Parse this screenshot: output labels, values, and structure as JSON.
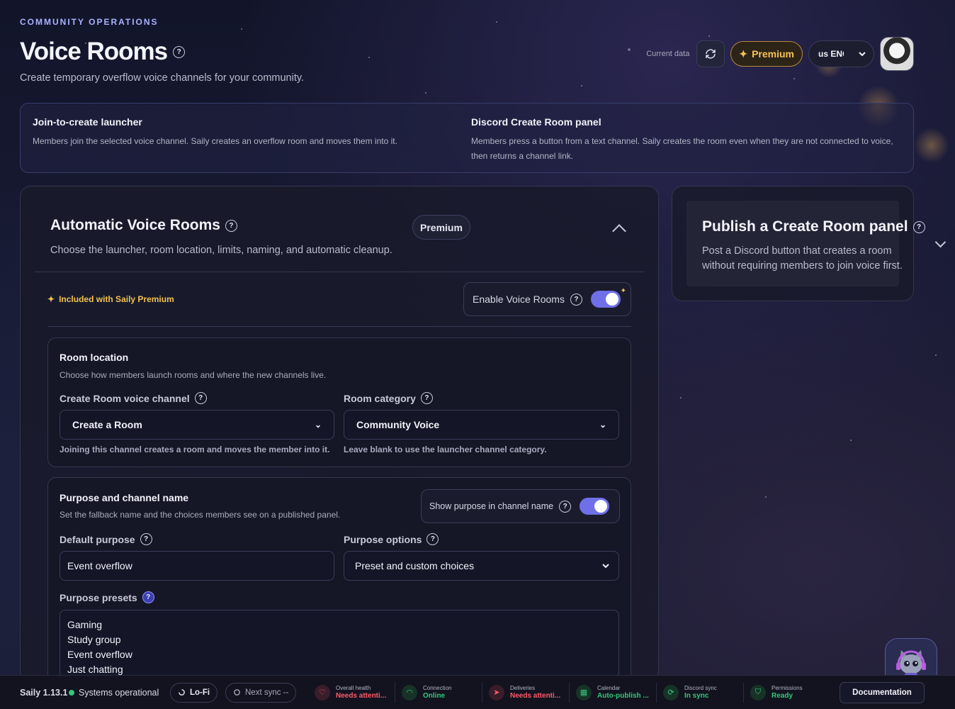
{
  "header": {
    "eyebrow": "COMMUNITY OPERATIONS",
    "title": "Voice Rooms",
    "help": "?",
    "subtitle": "Create temporary overflow voice channels for your community."
  },
  "topbar": {
    "current_data_label": "Current data",
    "refresh_icon": "refresh-icon",
    "premium_label": "Premium",
    "premium_star": "✦",
    "language_value": "us ENG",
    "avatar_icon": "avatar"
  },
  "info": {
    "left_title": "Join-to-create launcher",
    "left_text": "Members join the selected voice channel. Saily creates an overflow room and moves them into it.",
    "right_title": "Discord Create Room panel",
    "right_text": "Members press a button from a text channel. Saily creates the room even when they are not connected to voice, then returns a channel link."
  },
  "auto": {
    "title": "Automatic Voice Rooms",
    "subtitle": "Choose the launcher, room location, limits, naming, and automatic cleanup.",
    "premium_pill": "Premium",
    "included": "Included with Saily Premium",
    "included_star": "✦",
    "enable_label": "Enable Voice Rooms",
    "enable_on": true
  },
  "room_location": {
    "title": "Room location",
    "desc": "Choose how members launch rooms and where the new channels live.",
    "voice_channel_label": "Create Room voice channel",
    "voice_channel_value": "Create a Room",
    "voice_channel_hint": "Joining this channel creates a room and moves the member into it.",
    "category_label": "Room category",
    "category_value": "Community Voice",
    "category_hint": "Leave blank to use the launcher channel category.",
    "chevron": "⌄"
  },
  "purpose": {
    "title": "Purpose and channel name",
    "desc": "Set the fallback name and the choices members see on a published panel.",
    "show_purpose_label": "Show purpose in channel name",
    "show_purpose_on": true,
    "default_label": "Default purpose",
    "default_value": "Event overflow",
    "options_label": "Purpose options",
    "options_value": "Preset and custom choices",
    "presets_label": "Purpose presets",
    "presets": [
      "Gaming",
      "Study group",
      "Event overflow",
      "Just chatting"
    ]
  },
  "publish": {
    "title": "Publish a Create Room panel",
    "subtitle": "Post a Discord button that creates a room without requiring members to join voice first."
  },
  "footer": {
    "version": "Saily 1.13.1",
    "status": "Systems operational",
    "lofi": "Lo-Fi",
    "next_sync": "Next sync --",
    "stats": [
      {
        "label": "Overall health",
        "value": "Needs attenti...",
        "color": "#ff5a6a",
        "icon": "heart-icon"
      },
      {
        "label": "Connection",
        "value": "Online",
        "color": "#34c77b",
        "icon": "wifi-icon"
      },
      {
        "label": "Deliveries",
        "value": "Needs attenti...",
        "color": "#ff5a6a",
        "icon": "send-icon"
      },
      {
        "label": "Calendar",
        "value": "Auto-publish ...",
        "color": "#34c77b",
        "icon": "calendar-icon"
      },
      {
        "label": "Discord sync",
        "value": "In sync",
        "color": "#34c77b",
        "icon": "sync-icon"
      },
      {
        "label": "Permissions",
        "value": "Ready",
        "color": "#34c77b",
        "icon": "shield-icon"
      }
    ],
    "documentation": "Documentation"
  },
  "colors": {
    "accent": "#6f6fe8",
    "premium": "#f7c257",
    "ok": "#34c77b",
    "warn": "#ff5a6a"
  }
}
